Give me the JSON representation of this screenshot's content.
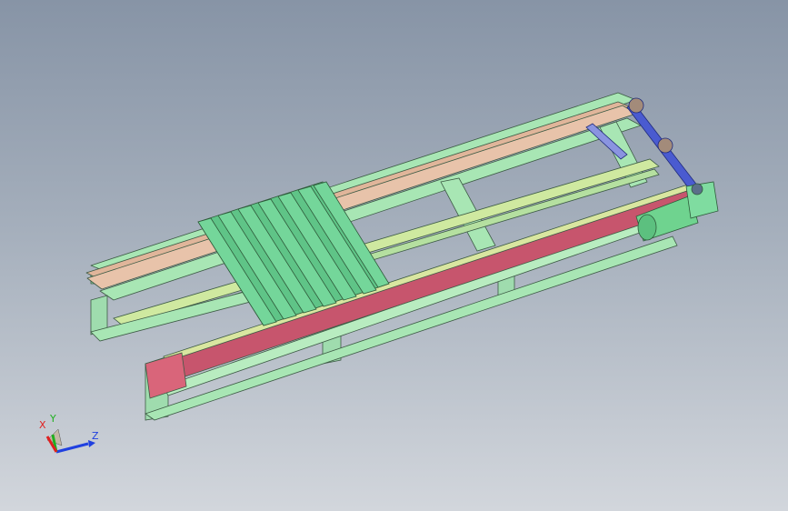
{
  "view": {
    "background_top": "#8794a6",
    "background_bottom": "#d2d6dc"
  },
  "model": {
    "frame_color": "#a8e6b4",
    "pallet_color": "#74d69a",
    "rail_color": "#e0b59a",
    "chain_guard_color": "#c7556d",
    "motor_color": "#6fd38f",
    "shaft_color": "#4a5bd0"
  },
  "triad": {
    "x_label": "X",
    "y_label": "Y",
    "z_label": "Z",
    "x_color": "#e02020",
    "y_color": "#20b020",
    "z_color": "#2040e0"
  }
}
